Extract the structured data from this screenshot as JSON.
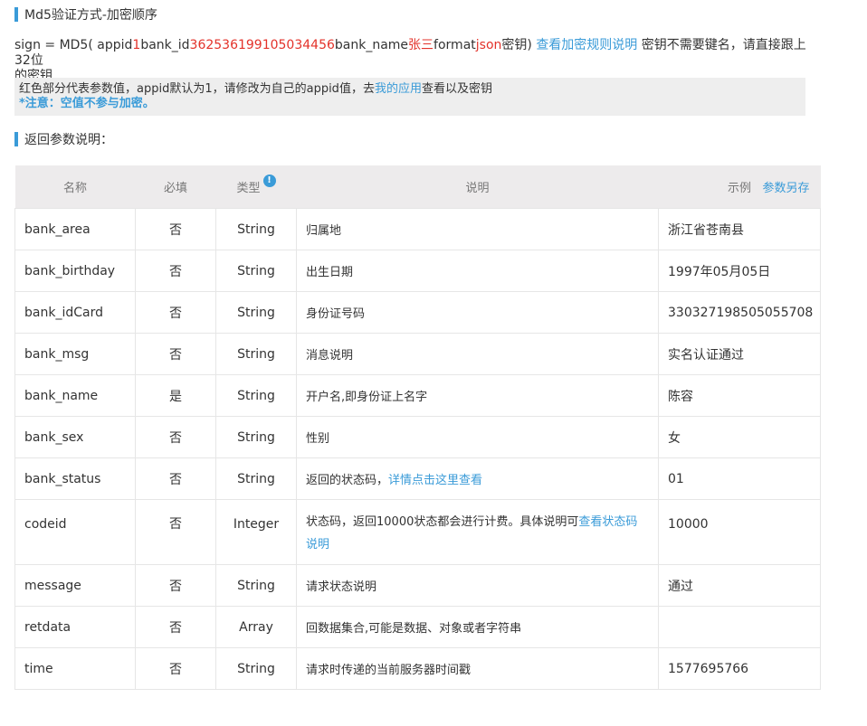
{
  "md5_section": {
    "title": "Md5验证方式-加密顺序"
  },
  "sign": {
    "prefix": "sign = MD5( appid",
    "appid_value": "1",
    "bank_id_key": "bank_id",
    "bank_id_value": "362536199105034456",
    "bank_name_key": "bank_name",
    "bank_name_value": "张三",
    "format_key": "format",
    "format_value": "json",
    "suffix": "密钥)",
    "rule_link": "查看加密规则说明",
    "note_line1": " 密钥不需要键名，请直接跟上32位",
    "note_line2": "的密钥"
  },
  "notice": {
    "text_before": "红色部分代表参数值，appid默认为1，请修改为自己的appid值，去",
    "link": "我的应用",
    "text_after": "查看以及密钥",
    "warning": "*注意：空值不参与加密。"
  },
  "return_section": {
    "title": "返回参数说明："
  },
  "table": {
    "headers": {
      "name": "名称",
      "required": "必填",
      "type": "类型",
      "type_info_icon": "!",
      "desc": "说明",
      "example": "示例",
      "save": "参数另存"
    },
    "rows": [
      {
        "name": "bank_area",
        "required": "否",
        "type": "String",
        "desc": "归属地",
        "example": "浙江省苍南县"
      },
      {
        "name": "bank_birthday",
        "required": "否",
        "type": "String",
        "desc": "出生日期",
        "example": "1997年05月05日"
      },
      {
        "name": "bank_idCard",
        "required": "否",
        "type": "String",
        "desc": "身份证号码",
        "example": "330327198505055708"
      },
      {
        "name": "bank_msg",
        "required": "否",
        "type": "String",
        "desc": "消息说明",
        "example": "实名认证通过"
      },
      {
        "name": "bank_name",
        "required": "是",
        "type": "String",
        "desc": "开户名,即身份证上名字",
        "example": "陈容"
      },
      {
        "name": "bank_sex",
        "required": "否",
        "type": "String",
        "desc": "性别",
        "example": "女"
      },
      {
        "name": "bank_status",
        "required": "否",
        "type": "String",
        "desc": "返回的状态码，",
        "desc_link": "详情点击这里查看",
        "example": "01"
      },
      {
        "name": "codeid",
        "required": "否",
        "type": "Integer",
        "desc": "状态码，返回10000状态都会进行计费。具体说明可",
        "desc_link": "查看状态码说明",
        "example": "10000"
      },
      {
        "name": "message",
        "required": "否",
        "type": "String",
        "desc": "请求状态说明",
        "example": "通过"
      },
      {
        "name": "retdata",
        "required": "否",
        "type": "Array",
        "desc": "回数据集合,可能是数据、对象或者字符串",
        "example": ""
      },
      {
        "name": "time",
        "required": "否",
        "type": "String",
        "desc": "请求时传递的当前服务器时间戳",
        "example": "1577695766"
      }
    ]
  },
  "colors": {
    "accent": "#3a9bd8",
    "param_value": "#e3322a",
    "header_bg": "#edebec",
    "notice_bg": "#eeeeee"
  }
}
